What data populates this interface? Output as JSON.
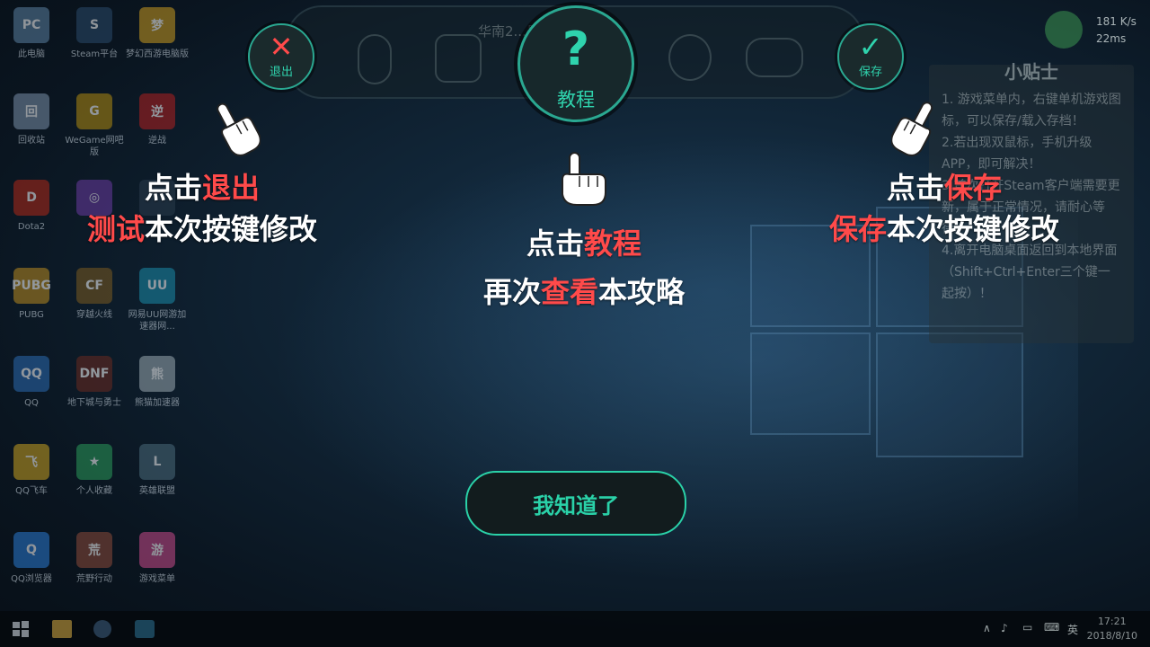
{
  "desktop": {
    "icons": [
      {
        "label": "此电脑",
        "color": "#5a7fa0",
        "glyph": "PC"
      },
      {
        "label": "Steam平台",
        "color": "#2a4a6a",
        "glyph": "S"
      },
      {
        "label": "梦幻西游电脑版",
        "color": "#c89a20",
        "glyph": "梦"
      },
      {
        "label": "回收站",
        "color": "#7a8fa8",
        "glyph": "回"
      },
      {
        "label": "WeGame网吧版",
        "color": "#b08a10",
        "glyph": "G"
      },
      {
        "label": "逆战",
        "color": "#b02020",
        "glyph": "逆"
      },
      {
        "label": "Dota2",
        "color": "#b02818",
        "glyph": "D"
      },
      {
        "label": "",
        "color": "#6a3aa0",
        "glyph": "◎"
      },
      {
        "label": "",
        "color": "#2a3a4a",
        "glyph": ""
      },
      {
        "label": "PUBG",
        "color": "#b88a20",
        "glyph": "PUBG"
      },
      {
        "label": "穿越火线",
        "color": "#7a5a20",
        "glyph": "CF"
      },
      {
        "label": "网易UU网游加速器网...",
        "color": "#1a8aa8",
        "glyph": "UU"
      },
      {
        "label": "QQ",
        "color": "#2a6ab0",
        "glyph": "QQ"
      },
      {
        "label": "地下城与勇士",
        "color": "#6a2a20",
        "glyph": "DNF"
      },
      {
        "label": "熊猫加速器",
        "color": "#9aa8b0",
        "glyph": "熊"
      },
      {
        "label": "QQ飞车",
        "color": "#c8a020",
        "glyph": "飞"
      },
      {
        "label": "个人收藏",
        "color": "#2a9a5a",
        "glyph": "★"
      },
      {
        "label": "英雄联盟",
        "color": "#4a6a7a",
        "glyph": "L"
      },
      {
        "label": "QQ浏览器",
        "color": "#2a7ad0",
        "glyph": "Q"
      },
      {
        "label": "荒野行动",
        "color": "#8a4a3a",
        "glyph": "荒"
      },
      {
        "label": "游戏菜单",
        "color": "#c84a8a",
        "glyph": "游"
      }
    ]
  },
  "toolbar": {
    "title": "华南2...号机",
    "exit": {
      "icon": "close-icon",
      "label": "退出"
    },
    "tutorial": {
      "icon": "question-icon",
      "label": "教程"
    },
    "save": {
      "icon": "check-icon",
      "label": "保存"
    }
  },
  "network": {
    "speed": "181 K/s",
    "latency": "22ms"
  },
  "tips": {
    "title": "小贴士",
    "lines": [
      "1. 游戏菜单内，右键单机游戏图标，可以保存/载入存档！",
      "2.若出现双鼠标，手机升级APP，即可解决！",
      "3.首次打开Steam客户端需要更新，属于正常情况，请耐心等待。",
      "4.离开电脑桌面返回到本地界面（Shift+Ctrl+Enter三个键一起按）！"
    ]
  },
  "guides": {
    "left_line1_pre": "点击",
    "left_line1_hl": "退出",
    "left_line2_hl": "测试",
    "left_line2_post": "本次按键修改",
    "center_line1_pre": "点击",
    "center_line1_hl": "教程",
    "center_line2_pre": "再次",
    "center_line2_hl": "查看",
    "center_line2_post": "本攻略",
    "right_line1_pre": "点击",
    "right_line1_hl": "保存",
    "right_line2_hl": "保存",
    "right_line2_post": "本次按键修改"
  },
  "confirm_button": "我知道了",
  "taskbar": {
    "ime": "英",
    "time": "17:21",
    "date": "2018/8/10"
  },
  "colors": {
    "accent": "#2ad1a8",
    "highlight": "#ff4a4a",
    "exit_x": "#ff4a4a"
  }
}
